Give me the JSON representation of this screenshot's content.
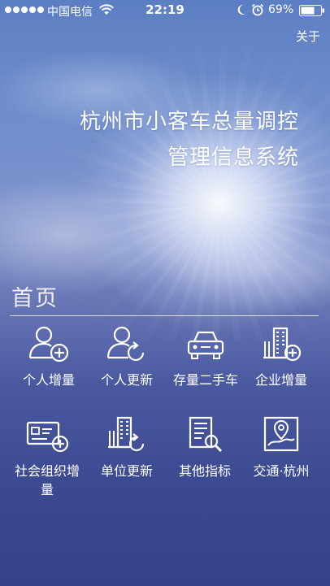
{
  "status_bar": {
    "carrier": "中国电信",
    "time": "22:19",
    "battery": "69%"
  },
  "header": {
    "about_label": "关于",
    "title_line1": "杭州市小客车总量调控",
    "title_line2": "管理信息系统"
  },
  "section": {
    "title": "首页"
  },
  "menu": {
    "items": [
      {
        "label": "个人增量",
        "icon": "person-add-icon"
      },
      {
        "label": "个人更新",
        "icon": "person-refresh-icon"
      },
      {
        "label": "存量二手车",
        "icon": "car-icon"
      },
      {
        "label": "企业增量",
        "icon": "building-add-icon"
      },
      {
        "label": "社会组织增量",
        "icon": "card-add-icon"
      },
      {
        "label": "单位更新",
        "icon": "building-refresh-icon"
      },
      {
        "label": "其他指标",
        "icon": "document-search-icon"
      },
      {
        "label": "交通·杭州",
        "icon": "map-pin-icon"
      }
    ]
  },
  "colors": {
    "background_top": "#5c7ec3",
    "background_bottom": "#34428a",
    "text": "#ffffff"
  }
}
